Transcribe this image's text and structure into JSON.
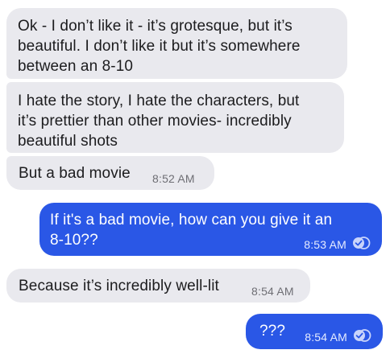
{
  "messages": [
    {
      "direction": "incoming",
      "lines": [
        "Ok - I don’t like it - it’s grotesque, but it’s",
        "beautiful. I don’t like it but it’s somewhere",
        "between an 8-10"
      ]
    },
    {
      "direction": "incoming",
      "lines": [
        "I hate the story, I hate the characters, but",
        "it’s prettier than other movies- incredibly",
        "beautiful shots"
      ]
    },
    {
      "direction": "incoming",
      "text": "But a bad movie",
      "time": "8:52 AM"
    },
    {
      "direction": "outgoing",
      "lines": [
        "If it's a bad movie, how can you give it an",
        "8-10??"
      ],
      "time": "8:53 AM",
      "status_icon": "read-receipt-icon"
    },
    {
      "direction": "incoming",
      "text": "Because it’s incredibly well-lit",
      "time": "8:54 AM"
    },
    {
      "direction": "outgoing",
      "text": "???",
      "time": "8:54 AM",
      "status_icon": "read-receipt-icon"
    }
  ],
  "colors": {
    "incoming_bubble": "#e9e9ee",
    "outgoing_bubble": "#2a57e6",
    "background": "#ffffff"
  }
}
